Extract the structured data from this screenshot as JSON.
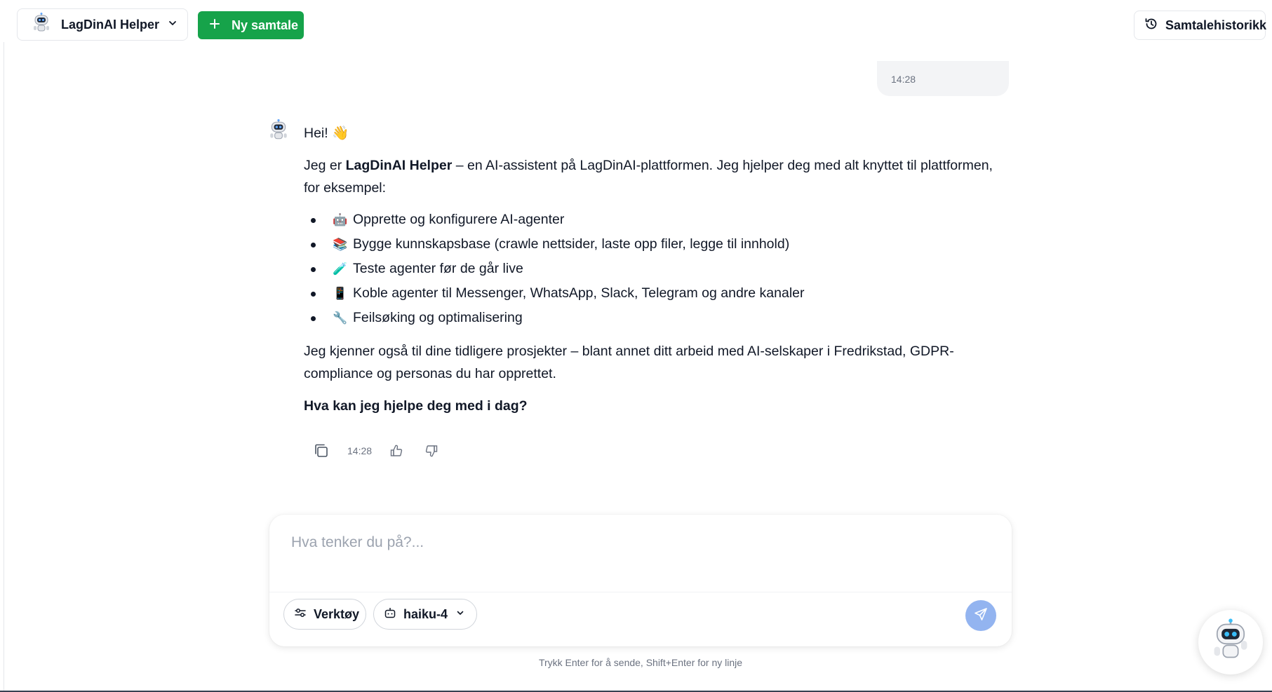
{
  "header": {
    "agent_name": "LagDinAI Helper",
    "new_chat_label": "Ny samtale",
    "history_label": "Samtalehistorikk"
  },
  "user_message": {
    "time": "14:28"
  },
  "assistant_message": {
    "greeting": "Hei! 👋",
    "intro_pre": "Jeg er ",
    "intro_bold": "LagDinAI Helper",
    "intro_post": " – en AI-assistent på LagDinAI-plattformen. Jeg hjelper deg med alt knyttet til plattformen, for eksempel:",
    "items": [
      {
        "emoji": "🤖",
        "text": "Opprette og konfigurere AI-agenter"
      },
      {
        "emoji": "📚",
        "text": "Bygge kunnskapsbase (crawle nettsider, laste opp filer, legge til innhold)"
      },
      {
        "emoji": "🧪",
        "text": "Teste agenter før de går live"
      },
      {
        "emoji": "📱",
        "text": "Koble agenter til Messenger, WhatsApp, Slack, Telegram og andre kanaler"
      },
      {
        "emoji": "🔧",
        "text": "Feilsøking og optimalisering"
      }
    ],
    "known": "Jeg kjenner også til dine tidligere prosjekter – blant annet ditt arbeid med AI-selskaper i Fredrikstad, GDPR-compliance og personas du har opprettet.",
    "question": "Hva kan jeg hjelpe deg med i dag?",
    "time": "14:28"
  },
  "composer": {
    "placeholder": "Hva tenker du på?...",
    "value": "",
    "tools_label": "Verktøy",
    "model_label": "haiku-4"
  },
  "hint": "Trykk Enter for å sende, Shift+Enter for ny linje",
  "colors": {
    "primary_green": "#16a34a",
    "send_button": "#93b4f0",
    "bubble_bg": "#f3f4f6"
  },
  "icons": {
    "agent": "robot-avatar-icon",
    "new_chat": "plus-icon",
    "history": "history-clock-icon",
    "copy": "copy-icon",
    "like": "thumbs-up-icon",
    "dislike": "thumbs-down-icon",
    "tools": "sliders-icon",
    "model": "bot-icon",
    "send": "send-icon"
  }
}
